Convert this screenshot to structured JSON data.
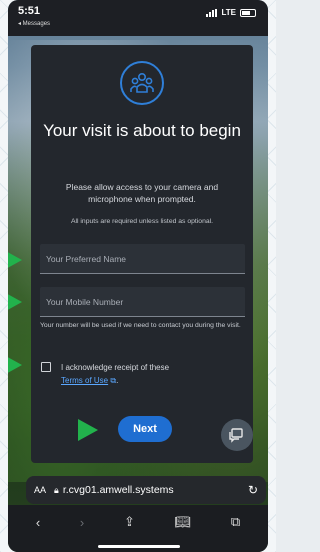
{
  "status": {
    "time": "5:51",
    "back_label": "◂ Messages",
    "carrier": "LTE"
  },
  "card": {
    "title": "Your visit is about to begin",
    "description": "Please allow access to your camera and microphone when prompted.",
    "required_note": "All inputs are required unless listed as optional.",
    "name_placeholder": "Your Preferred Name",
    "phone_placeholder": "Your Mobile Number",
    "phone_hint": "Your number will be used if we need to contact you during the visit.",
    "ack_text": "I acknowledge receipt of these",
    "terms_link": "Terms of Use",
    "next_label": "Next"
  },
  "browser": {
    "aa_label": "AA",
    "url": "r.cvg01.amwell.systems"
  },
  "colors": {
    "accent": "#1f6ed1",
    "link": "#5aa7ff",
    "card_bg": "#23272d",
    "arrow": "#22b24c"
  },
  "icons": [
    "signal-icon",
    "battery-icon",
    "patients-icon",
    "external-link-icon",
    "chat-icon",
    "lock-icon",
    "reload-icon",
    "back-icon",
    "forward-icon",
    "share-icon",
    "bookmarks-icon",
    "tabs-icon"
  ]
}
